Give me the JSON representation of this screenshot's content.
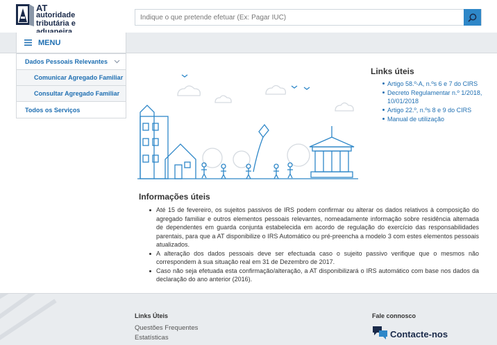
{
  "header": {
    "logo_line1": "AT",
    "logo_line2": "autoridade",
    "logo_line3": "tributária e aduaneira",
    "search_placeholder": "Indique o que pretende efetuar (Ex: Pagar IUC)"
  },
  "menu": {
    "label": "MENU"
  },
  "sidebar": {
    "items": [
      {
        "label": "Dados Pessoais Relevantes"
      },
      {
        "label": "Comunicar Agregado Familiar"
      },
      {
        "label": "Consultar Agregado Familiar"
      },
      {
        "label": "Todos os Serviços"
      }
    ]
  },
  "links_uteis": {
    "title": "Links úteis",
    "items": [
      "Artigo 58.º-A, n.ºs 6 e 7 do CIRS",
      "Decreto Regulamentar n.º 1/2018, 10/01/2018",
      "Artigo 22.º, n.ºs 8 e 9 do CIRS",
      "Manual de utilização"
    ]
  },
  "informacoes": {
    "title": "Informações úteis",
    "items": [
      "Até 15 de fevereiro, os sujeitos passivos de IRS podem confirmar ou alterar os dados relativos à composição do agregado familiar e outros elementos pessoais relevantes, nomeadamente informação sobre residência alternada de dependentes em guarda conjunta estabelecida em acordo de regulação do exercício das responsabilidades parentais, para que a AT disponibilize o IRS Automático ou pré-preencha a modelo 3 com estes elementos pessoais atualizados.",
      "A alteração dos dados pessoais deve ser efectuada caso o sujeito passivo verifique que o mesmos não correspondem à sua situação real em 31 de Dezembro de 2017.",
      "Caso não seja efetuada esta confirmação/alteração, a AT disponibilizará o IRS automático com base nos dados da declaração do ano anterior (2016)."
    ]
  },
  "footer": {
    "col1_title": "Links Úteis",
    "col1_items": [
      "Questões Frequentes",
      "Estatísticas"
    ],
    "col2_title": "Fale connosco",
    "contact_label": "Contacte-nos"
  },
  "colors": {
    "accent": "#2e87c8",
    "link": "#1f6fb2",
    "navbar": "#e9ecef"
  }
}
